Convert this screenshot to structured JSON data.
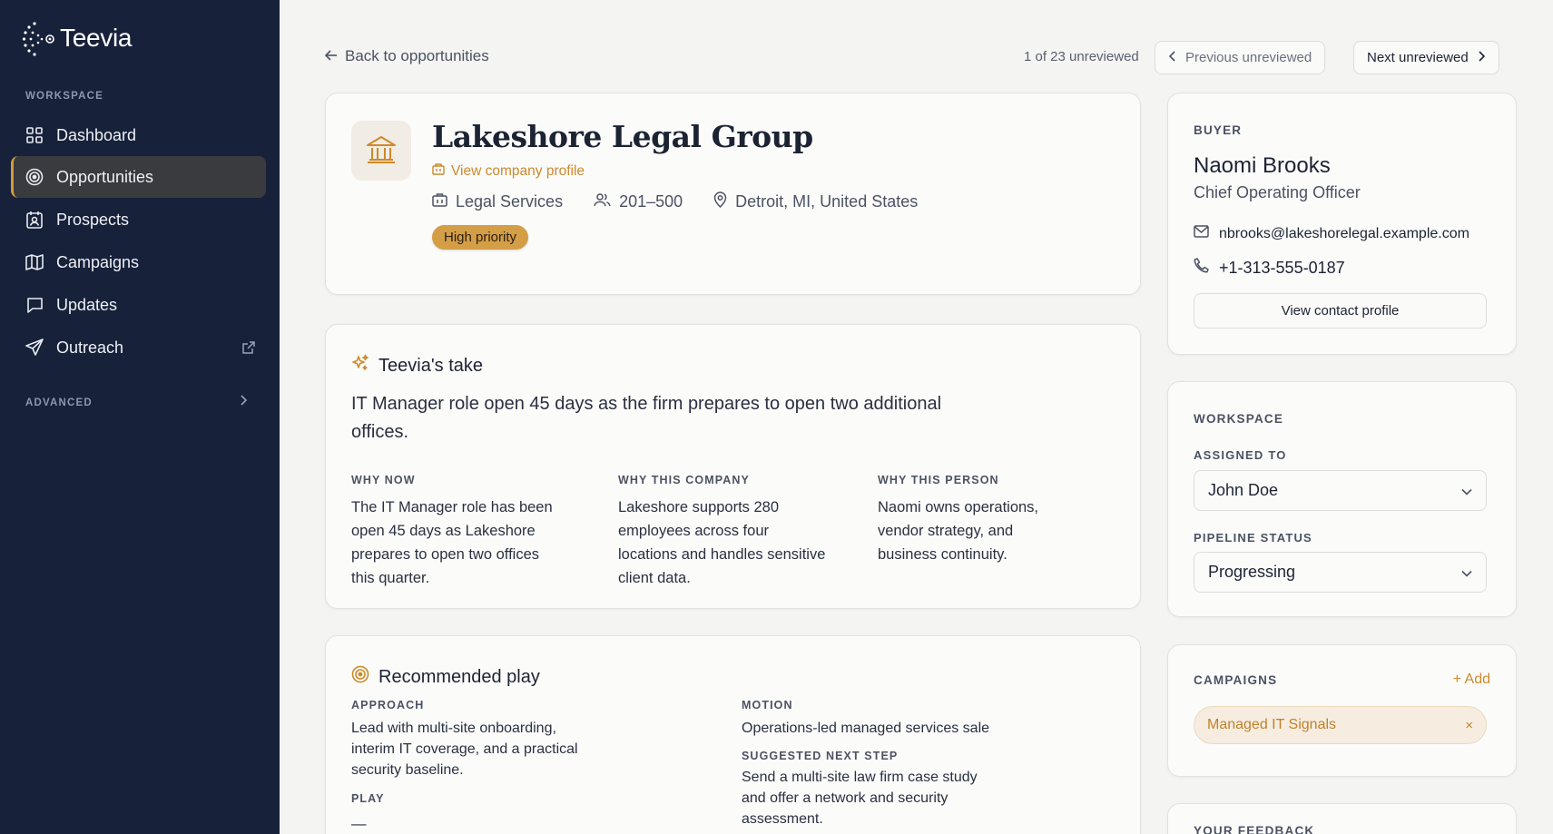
{
  "app": {
    "name": "Teevia"
  },
  "sidebar": {
    "workspace_heading": "WORKSPACE",
    "items": [
      {
        "label": "Dashboard",
        "icon": "grid-icon"
      },
      {
        "label": "Opportunities",
        "icon": "target-icon",
        "active": true
      },
      {
        "label": "Prospects",
        "icon": "contact-card-icon"
      },
      {
        "label": "Campaigns",
        "icon": "map-icon"
      },
      {
        "label": "Updates",
        "icon": "message-square-icon"
      },
      {
        "label": "Outreach",
        "icon": "send-icon",
        "external": true
      }
    ],
    "advanced_heading": "ADVANCED"
  },
  "topbar": {
    "back_label": "Back to opportunities",
    "counter": "1 of 23 unreviewed",
    "prev_label": "Previous unreviewed",
    "next_label": "Next unreviewed"
  },
  "company": {
    "name": "Lakeshore Legal Group",
    "profile_link": "View company profile",
    "industry": "Legal Services",
    "employees": "201–500",
    "location": "Detroit, MI, United States",
    "priority": "High priority"
  },
  "take": {
    "title": "Teevia's take",
    "summary": "IT Manager role open 45 days as the firm prepares to open two additional offices.",
    "columns": [
      {
        "label": "WHY NOW",
        "text": "The IT Manager role has been open 45 days as Lakeshore prepares to open two offices this quarter."
      },
      {
        "label": "WHY THIS COMPANY",
        "text": "Lakeshore supports 280 employees across four locations and handles sensitive client data."
      },
      {
        "label": "WHY THIS PERSON",
        "text": "Naomi owns operations, vendor strategy, and business continuity."
      }
    ]
  },
  "play": {
    "title": "Recommended play",
    "approach_label": "APPROACH",
    "approach_text": "Lead with multi-site onboarding, interim IT coverage, and a practical security baseline.",
    "play_label": "PLAY",
    "play_text": "—",
    "motion_label": "MOTION",
    "motion_text": "Operations-led managed services sale",
    "next_step_label": "SUGGESTED NEXT STEP",
    "next_step_text": "Send a multi-site law firm case study and offer a network and security assessment."
  },
  "buyer": {
    "heading": "BUYER",
    "name": "Naomi Brooks",
    "title": "Chief Operating Officer",
    "email": "nbrooks@lakeshorelegal.example.com",
    "phone": "+1-313-555-0187",
    "contact_button": "View contact profile"
  },
  "workspace": {
    "heading": "WORKSPACE",
    "assigned_label": "ASSIGNED TO",
    "assigned_value": "John Doe",
    "status_label": "PIPELINE STATUS",
    "status_value": "Progressing"
  },
  "campaigns": {
    "heading": "CAMPAIGNS",
    "add_label": "+ Add",
    "chips": [
      "Managed IT Signals"
    ],
    "remove_glyph": "×"
  },
  "feedback": {
    "heading": "YOUR FEEDBACK"
  },
  "colors": {
    "sidebar_bg": "#17213a",
    "accent": "#cd8a2a",
    "badge": "#d49e47",
    "page_bg": "#f4f4f2"
  }
}
